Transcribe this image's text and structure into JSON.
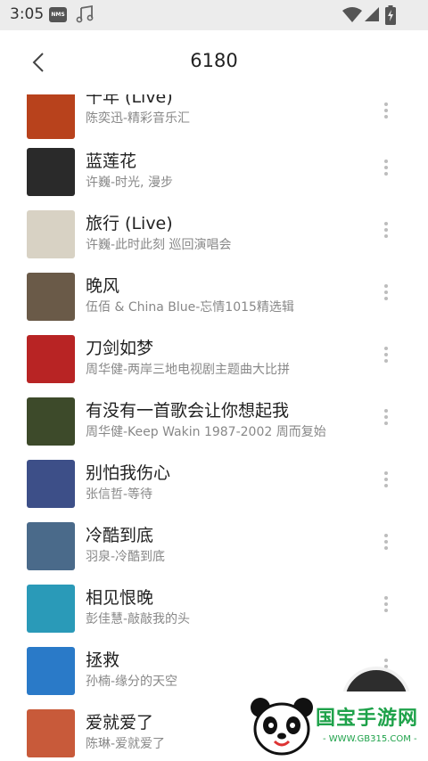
{
  "status_bar": {
    "time": "3:05",
    "nms_badge": "NMS"
  },
  "header": {
    "title": "6180"
  },
  "songs": [
    {
      "title": "千年 (Live)",
      "subtitle": "陈奕迅-精彩音乐汇",
      "cover_color": "#b8421c"
    },
    {
      "title": "蓝莲花",
      "subtitle": "许巍-时光, 漫步",
      "cover_color": "#2a2a2a"
    },
    {
      "title": "旅行 (Live)",
      "subtitle": "许巍-此时此刻 巡回演唱会",
      "cover_color": "#d8d2c4"
    },
    {
      "title": "晚风",
      "subtitle": "伍佰 & China Blue-忘情1015精选辑",
      "cover_color": "#6a5a48"
    },
    {
      "title": "刀剑如梦",
      "subtitle": "周华健-两岸三地电视剧主题曲大比拼",
      "cover_color": "#b82424"
    },
    {
      "title": "有没有一首歌会让你想起我",
      "subtitle": "周华健-Keep Wakin 1987-2002 周而复始",
      "cover_color": "#3d4a2a"
    },
    {
      "title": "别怕我伤心",
      "subtitle": "张信哲-等待",
      "cover_color": "#3d4f88"
    },
    {
      "title": "冷酷到底",
      "subtitle": "羽泉-冷酷到底",
      "cover_color": "#4a6a8a"
    },
    {
      "title": "相见恨晚",
      "subtitle": "彭佳慧-敲敲我的头",
      "cover_color": "#2a9ab8"
    },
    {
      "title": "拯救",
      "subtitle": "孙楠-缘分的天空",
      "cover_color": "#2a7ac8"
    },
    {
      "title": "爱就爱了",
      "subtitle": "陈琳-爱就爱了",
      "cover_color": "#c85a3a"
    }
  ],
  "watermark": {
    "text": "国宝手游网",
    "url": "- WWW.GB315.COM -"
  },
  "colors": {
    "status_bar": "#ececec",
    "title_text": "#222222",
    "subtitle_text": "#888888",
    "fab": "#2d2d2d",
    "watermark_green": "#1ea24a"
  }
}
